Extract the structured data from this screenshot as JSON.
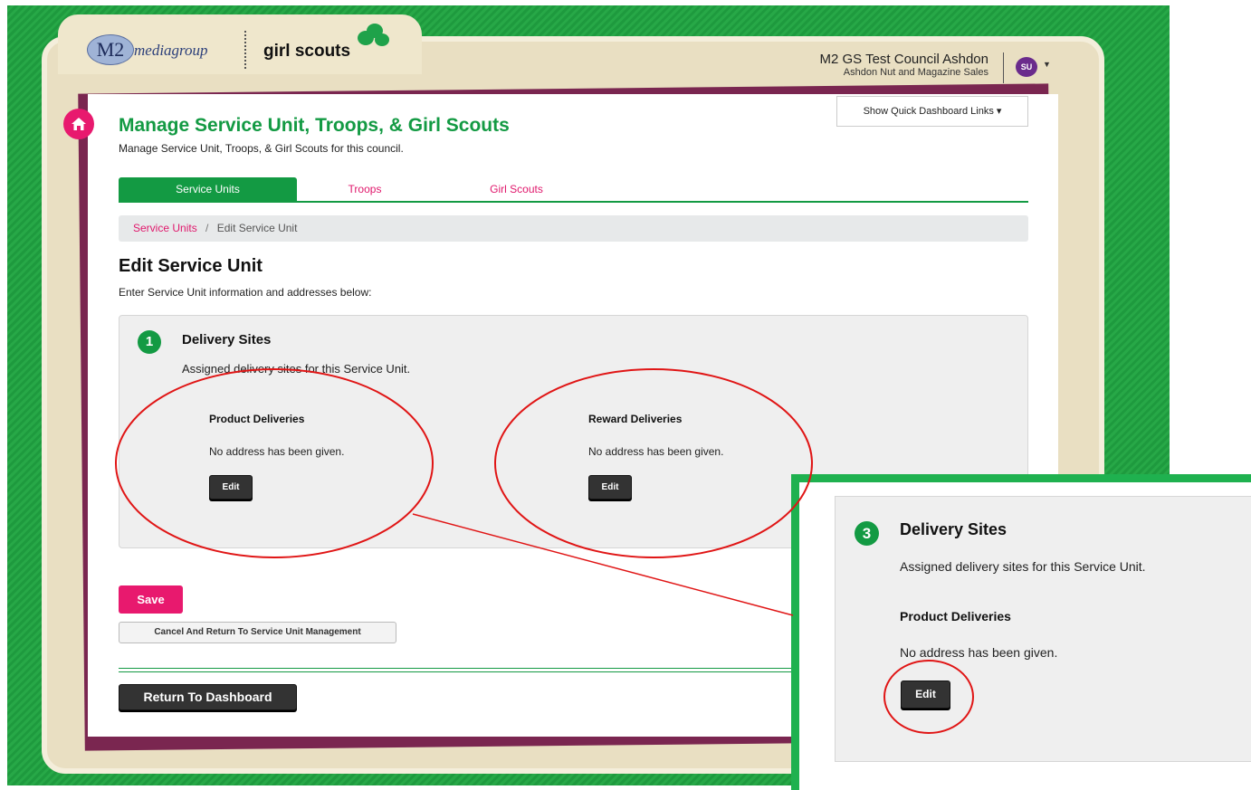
{
  "header": {
    "logo_m2": "M2",
    "logo_media": "mediagroup",
    "logo_gs": "girl scouts",
    "account_name": "M2 GS Test Council Ashdon",
    "account_sub": "Ashdon Nut and Magazine Sales",
    "avatar_initials": "SU",
    "quick_links_label": "Show Quick Dashboard Links ▾"
  },
  "page": {
    "title": "Manage Service Unit, Troops, & Girl Scouts",
    "subtitle": "Manage Service Unit, Troops, & Girl Scouts for this council.",
    "tabs": [
      {
        "label": "Service Units",
        "active": true
      },
      {
        "label": "Troops",
        "active": false
      },
      {
        "label": "Girl Scouts",
        "active": false
      }
    ],
    "breadcrumb": {
      "link": "Service Units",
      "sep": "/",
      "current": "Edit Service Unit"
    },
    "section_title": "Edit Service Unit",
    "section_sub": "Enter Service Unit information and addresses below:"
  },
  "delivery": {
    "step": "1",
    "title": "Delivery Sites",
    "description": "Assigned delivery sites for this Service Unit.",
    "product": {
      "heading": "Product Deliveries",
      "text": "No address has been given.",
      "edit_label": "Edit"
    },
    "reward": {
      "heading": "Reward Deliveries",
      "text": "No address has been given.",
      "edit_label": "Edit"
    }
  },
  "actions": {
    "save": "Save",
    "cancel": "Cancel And Return To Service Unit Management",
    "return": "Return To Dashboard"
  },
  "zoom": {
    "step": "3",
    "title": "Delivery Sites",
    "description": "Assigned delivery sites for this Service Unit.",
    "heading": "Product Deliveries",
    "text": "No address has been given.",
    "edit_label": "Edit"
  },
  "colors": {
    "brand_green": "#139a43",
    "brand_pink": "#e0186c",
    "annotation_red": "#e01515"
  }
}
